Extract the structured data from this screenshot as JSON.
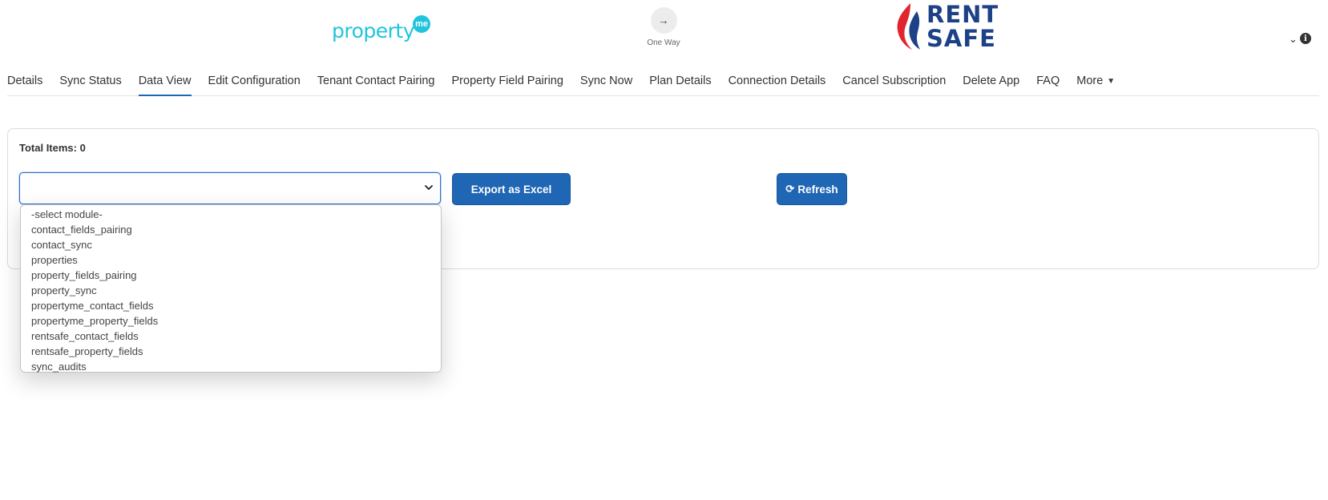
{
  "header": {
    "left_logo": {
      "word": "property",
      "badge": "me"
    },
    "sync_direction": {
      "icon": "arrow-right-icon",
      "label": "One Way"
    },
    "right_logo": {
      "line1": "RENT",
      "line2": "SAFE"
    },
    "icons": [
      "chevron-down-icon",
      "info-icon"
    ]
  },
  "tabs": [
    {
      "label": "Details"
    },
    {
      "label": "Sync Status"
    },
    {
      "label": "Data View",
      "active": true
    },
    {
      "label": "Edit Configuration"
    },
    {
      "label": "Tenant Contact Pairing"
    },
    {
      "label": "Property Field Pairing"
    },
    {
      "label": "Sync Now"
    },
    {
      "label": "Plan Details"
    },
    {
      "label": "Connection Details"
    },
    {
      "label": "Cancel Subscription"
    },
    {
      "label": "Delete App"
    },
    {
      "label": "FAQ"
    },
    {
      "label": "More"
    }
  ],
  "card": {
    "total_items": "Total Items: 0",
    "export_label": "Export as Excel",
    "refresh_label": "Refresh"
  },
  "module_select": {
    "value": "",
    "options": [
      "-select module-",
      "contact_fields_pairing",
      "contact_sync",
      "properties",
      "property_fields_pairing",
      "property_sync",
      "propertyme_contact_fields",
      "propertyme_property_fields",
      "rentsafe_contact_fields",
      "rentsafe_property_fields",
      "sync_audits"
    ]
  },
  "colors": {
    "primary": "#1f66b5",
    "propertyme_teal": "#21c4dc",
    "rentsafe_navy": "#1d4187",
    "rentsafe_red": "#e0252f"
  }
}
